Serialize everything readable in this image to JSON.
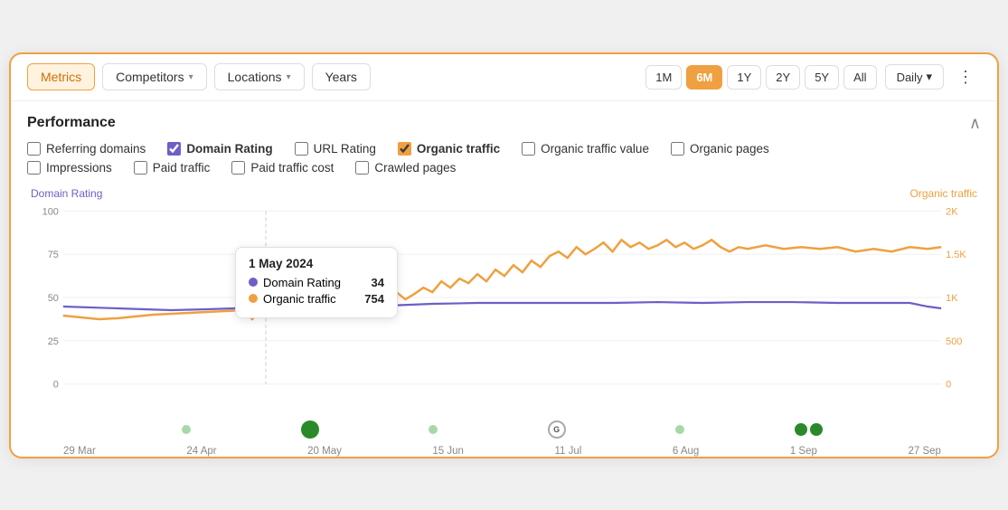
{
  "topbar": {
    "metrics_label": "Metrics",
    "competitors_label": "Competitors",
    "locations_label": "Locations",
    "years_label": "Years",
    "time_buttons": [
      "1M",
      "6M",
      "1Y",
      "2Y",
      "5Y",
      "All"
    ],
    "active_time": "6M",
    "granularity_label": "Daily",
    "more_icon": "⋮"
  },
  "performance": {
    "title": "Performance",
    "collapse_icon": "∧",
    "row1_checkboxes": [
      {
        "id": "cb-rd",
        "label": "Referring domains",
        "checked": false,
        "color": "default"
      },
      {
        "id": "cb-dr",
        "label": "Domain Rating",
        "checked": true,
        "color": "purple",
        "bold": true
      },
      {
        "id": "cb-ur",
        "label": "URL Rating",
        "checked": false,
        "color": "default"
      },
      {
        "id": "cb-ot",
        "label": "Organic traffic",
        "checked": true,
        "color": "orange",
        "bold": true
      },
      {
        "id": "cb-otv",
        "label": "Organic traffic value",
        "checked": false,
        "color": "default"
      },
      {
        "id": "cb-op",
        "label": "Organic pages",
        "checked": false,
        "color": "default"
      }
    ],
    "row2_checkboxes": [
      {
        "id": "cb-imp",
        "label": "Impressions",
        "checked": false,
        "color": "default"
      },
      {
        "id": "cb-pt",
        "label": "Paid traffic",
        "checked": false,
        "color": "default"
      },
      {
        "id": "cb-ptc",
        "label": "Paid traffic cost",
        "checked": false,
        "color": "default"
      },
      {
        "id": "cb-cp",
        "label": "Crawled pages",
        "checked": false,
        "color": "default"
      }
    ]
  },
  "chart": {
    "left_label": "Domain Rating",
    "right_label": "Organic traffic",
    "y_left": [
      "100",
      "75",
      "50",
      "25",
      "0"
    ],
    "y_right": [
      "2K",
      "1.5K",
      "1K",
      "500",
      "0"
    ],
    "x_labels": [
      "29 Mar",
      "24 Apr",
      "20 May",
      "15 Jun",
      "11 Jul",
      "6 Aug",
      "1 Sep",
      "27 Sep"
    ]
  },
  "tooltip": {
    "date": "1 May 2024",
    "rows": [
      {
        "color": "purple",
        "label": "Domain Rating",
        "value": "34"
      },
      {
        "color": "orange",
        "label": "Organic traffic",
        "value": "754"
      }
    ]
  }
}
